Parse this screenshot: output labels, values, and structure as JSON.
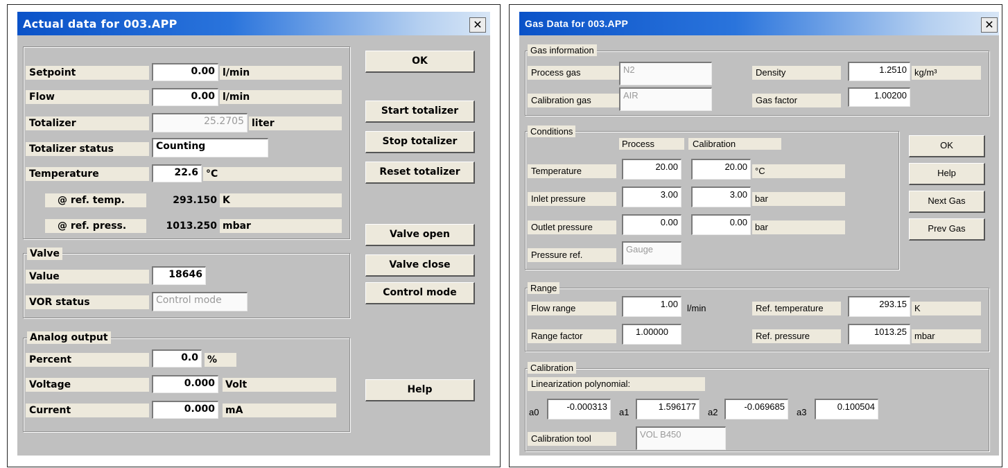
{
  "actual": {
    "title": "Actual data for 003.APP",
    "close": "✕",
    "rows": {
      "setpoint": {
        "label": "Setpoint",
        "value": "0.00",
        "unit": "l/min"
      },
      "flow": {
        "label": "Flow",
        "value": "0.00",
        "unit": "l/min"
      },
      "totalizer": {
        "label": "Totalizer",
        "value": "25.2705",
        "unit": "liter"
      },
      "totalizer_status": {
        "label": "Totalizer status",
        "value": "Counting"
      },
      "temperature": {
        "label": "Temperature",
        "value": "22.6",
        "unit": "°C"
      },
      "ref_temp": {
        "label": "@ ref. temp.",
        "value": "293.150",
        "unit": "K"
      },
      "ref_press": {
        "label": "@ ref. press.",
        "value": "1013.250",
        "unit": "mbar"
      }
    },
    "valve": {
      "group": "Valve",
      "value_label": "Value",
      "value": "18646",
      "vor_label": "VOR status",
      "vor_value": "Control mode"
    },
    "analog": {
      "group": "Analog output",
      "percent": {
        "label": "Percent",
        "value": "0.0",
        "unit": "%"
      },
      "voltage": {
        "label": "Voltage",
        "value": "0.000",
        "unit": "Volt"
      },
      "current": {
        "label": "Current",
        "value": "0.000",
        "unit": "mA"
      }
    },
    "buttons": {
      "ok": "OK",
      "start_totalizer": "Start totalizer",
      "stop_totalizer": "Stop totalizer",
      "reset_totalizer": "Reset totalizer",
      "valve_open": "Valve open",
      "valve_close": "Valve close",
      "control_mode": "Control mode",
      "help": "Help"
    }
  },
  "gas": {
    "title": "Gas Data for 003.APP",
    "close": "✕",
    "gas_info": {
      "group": "Gas information",
      "process_gas_label": "Process gas",
      "process_gas": "N2",
      "calibration_gas_label": "Calibration gas",
      "calibration_gas": "AIR",
      "density_label": "Density",
      "density": "1.2510",
      "density_unit": "kg/m³",
      "gas_factor_label": "Gas factor",
      "gas_factor": "1.00200"
    },
    "conditions": {
      "group": "Conditions",
      "process_header": "Process",
      "calibration_header": "Calibration",
      "temperature": {
        "label": "Temperature",
        "process": "20.00",
        "calibration": "20.00",
        "unit": "°C"
      },
      "inlet": {
        "label": "Inlet pressure",
        "process": "3.00",
        "calibration": "3.00",
        "unit": "bar"
      },
      "outlet": {
        "label": "Outlet pressure",
        "process": "0.00",
        "calibration": "0.00",
        "unit": "bar"
      },
      "pressure_ref_label": "Pressure ref.",
      "pressure_ref": "Gauge"
    },
    "range": {
      "group": "Range",
      "flow_range_label": "Flow range",
      "flow_range": "1.00",
      "flow_range_unit": "l/min",
      "range_factor_label": "Range factor",
      "range_factor": "1.00000",
      "ref_temp_label": "Ref. temperature",
      "ref_temp": "293.15",
      "ref_temp_unit": "K",
      "ref_press_label": "Ref. pressure",
      "ref_press": "1013.25",
      "ref_press_unit": "mbar"
    },
    "calibration": {
      "group": "Calibration",
      "poly_label": "Linearization polynomial:",
      "a0_label": "a0",
      "a0": "-0.000313",
      "a1_label": "a1",
      "a1": "1.596177",
      "a2_label": "a2",
      "a2": "-0.069685",
      "a3_label": "a3",
      "a3": "0.100504",
      "tool_label": "Calibration tool",
      "tool": "VOL B450"
    },
    "buttons": {
      "ok": "OK",
      "help": "Help",
      "next_gas": "Next Gas",
      "prev_gas": "Prev Gas"
    }
  }
}
